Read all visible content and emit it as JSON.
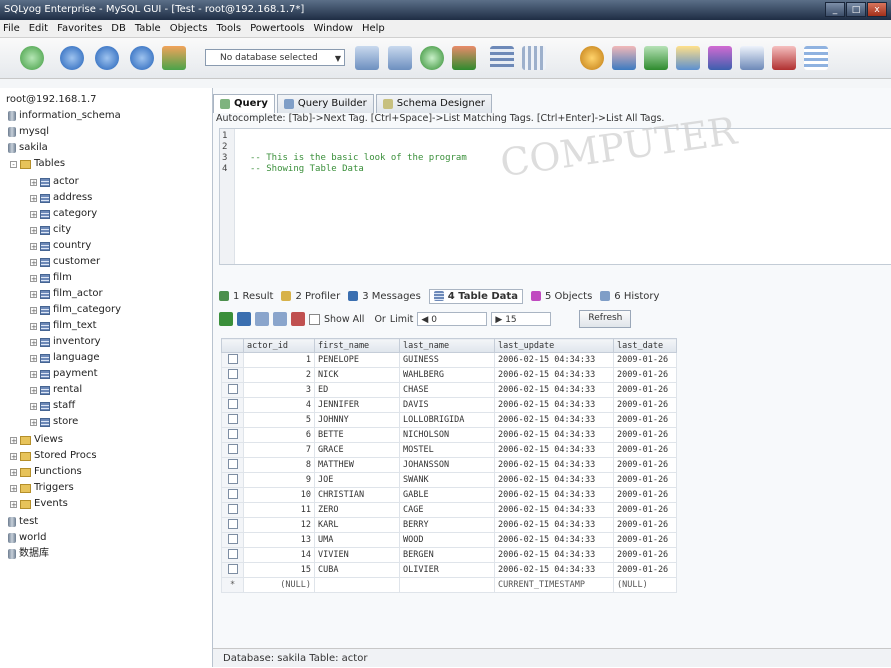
{
  "window": {
    "title": "SQLyog Enterprise - MySQL GUI - [Test - root@192.168.1.7*]"
  },
  "menu": [
    "File",
    "Edit",
    "Favorites",
    "DB",
    "Table",
    "Objects",
    "Tools",
    "Powertools",
    "Window",
    "Help"
  ],
  "toolbar": {
    "db_select": "No database selected"
  },
  "tree": {
    "root": "root@192.168.1.7",
    "databases_top": [
      "information_schema",
      "mysql",
      "sakila"
    ],
    "tables_folder": "Tables",
    "tables": [
      "actor",
      "address",
      "category",
      "city",
      "country",
      "customer",
      "film",
      "film_actor",
      "film_category",
      "film_text",
      "inventory",
      "language",
      "payment",
      "rental",
      "staff",
      "store"
    ],
    "folders": [
      "Views",
      "Stored Procs",
      "Functions",
      "Triggers",
      "Events"
    ],
    "databases_bottom": [
      "test",
      "world",
      "数据库"
    ]
  },
  "tabs_top": [
    "Query",
    "Query Builder",
    "Schema Designer"
  ],
  "autocomplete_hint": "Autocomplete: [Tab]->Next Tag. [Ctrl+Space]->List Matching Tags. [Ctrl+Enter]->List All Tags.",
  "editor": {
    "line_numbers": [
      "1",
      "2",
      "3",
      "4"
    ],
    "lines": [
      "",
      "",
      "-- This is the basic look of the program",
      "-- Showing Table Data"
    ]
  },
  "result_tabs": [
    "1 Result",
    "2 Profiler",
    "3 Messages",
    "4 Table Data",
    "5 Objects",
    "6 History"
  ],
  "grid_toolbar": {
    "show_all": "Show All",
    "or": "Or",
    "limit": "Limit",
    "offset": "0",
    "count": "15",
    "refresh": "Refresh"
  },
  "table": {
    "columns": [
      "actor_id",
      "first_name",
      "last_name",
      "last_update",
      "last_date"
    ],
    "rows": [
      [
        "1",
        "PENELOPE",
        "GUINESS",
        "2006-02-15 04:34:33",
        "2009-01-26"
      ],
      [
        "2",
        "NICK",
        "WAHLBERG",
        "2006-02-15 04:34:33",
        "2009-01-26"
      ],
      [
        "3",
        "ED",
        "CHASE",
        "2006-02-15 04:34:33",
        "2009-01-26"
      ],
      [
        "4",
        "JENNIFER",
        "DAVIS",
        "2006-02-15 04:34:33",
        "2009-01-26"
      ],
      [
        "5",
        "JOHNNY",
        "LOLLOBRIGIDA",
        "2006-02-15 04:34:33",
        "2009-01-26"
      ],
      [
        "6",
        "BETTE",
        "NICHOLSON",
        "2006-02-15 04:34:33",
        "2009-01-26"
      ],
      [
        "7",
        "GRACE",
        "MOSTEL",
        "2006-02-15 04:34:33",
        "2009-01-26"
      ],
      [
        "8",
        "MATTHEW",
        "JOHANSSON",
        "2006-02-15 04:34:33",
        "2009-01-26"
      ],
      [
        "9",
        "JOE",
        "SWANK",
        "2006-02-15 04:34:33",
        "2009-01-26"
      ],
      [
        "10",
        "CHRISTIAN",
        "GABLE",
        "2006-02-15 04:34:33",
        "2009-01-26"
      ],
      [
        "11",
        "ZERO",
        "CAGE",
        "2006-02-15 04:34:33",
        "2009-01-26"
      ],
      [
        "12",
        "KARL",
        "BERRY",
        "2006-02-15 04:34:33",
        "2009-01-26"
      ],
      [
        "13",
        "UMA",
        "WOOD",
        "2006-02-15 04:34:33",
        "2009-01-26"
      ],
      [
        "14",
        "VIVIEN",
        "BERGEN",
        "2006-02-15 04:34:33",
        "2009-01-26"
      ],
      [
        "15",
        "CUBA",
        "OLIVIER",
        "2006-02-15 04:34:33",
        "2009-01-26"
      ]
    ],
    "new_row": [
      "(NULL)",
      "",
      "",
      "CURRENT_TIMESTAMP",
      "(NULL)"
    ]
  },
  "status": "Database: sakila Table: actor",
  "colors": {
    "title_bg": "#1e2d44",
    "accent": "#3a6fb0",
    "comment": "#3a8f3a"
  }
}
